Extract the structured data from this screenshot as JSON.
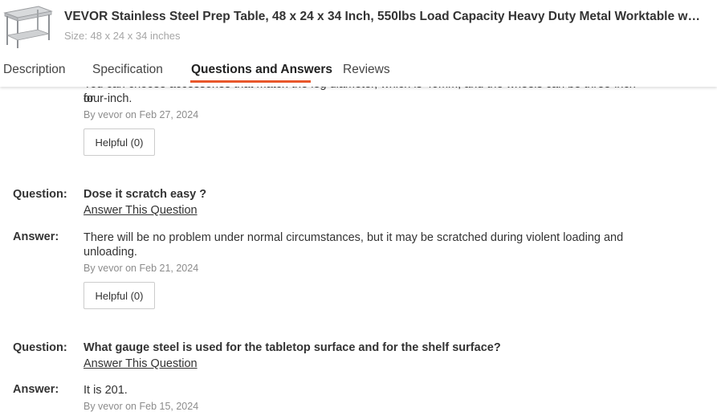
{
  "product": {
    "title": "VEVOR Stainless Steel Prep Table, 48 x 24 x 34 Inch, 550lbs Load Capacity Heavy Duty Metal Worktable with Adjustable Undershelf",
    "size": "Size: 48 x 24 x 34 inches"
  },
  "tabs": [
    {
      "label": "Description"
    },
    {
      "label": "Specification"
    },
    {
      "label": "Questions and Answers"
    },
    {
      "label": "Reviews"
    }
  ],
  "accent_color": "#e8562a",
  "qa": {
    "question_label": "Question:",
    "answer_label": "Answer:",
    "answer_link": "Answer This Question",
    "items": [
      {
        "answer_hidden": "You can choose accessories that match the leg diameter, which is 40mm, and the wheels can be three-inch or",
        "answer_visible": "four-inch.",
        "byline": "By vevor on Feb 27, 2024",
        "helpful": "Helpful (0)"
      },
      {
        "question": "Dose it scratch easy ?",
        "answer": "There will be no problem under normal circumstances, but it may be scratched during violent loading and unloading.",
        "byline": "By vevor on Feb 21, 2024",
        "helpful": "Helpful (0)"
      },
      {
        "question": "What gauge steel is used for the tabletop surface and for the shelf surface?",
        "answer": "It is 201.",
        "byline": "By vevor on Feb 15, 2024"
      }
    ]
  }
}
